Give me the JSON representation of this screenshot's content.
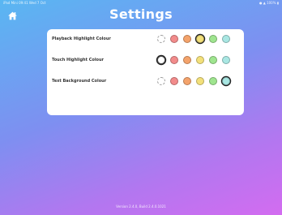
{
  "status_bar": {
    "left": "iPad Mini  09:41  Wed 7 Oct",
    "right": "● ▲ 100% ▮"
  },
  "home": {
    "icon": "home-icon"
  },
  "title": "Settings",
  "rows": [
    {
      "label": "Playback Highlight Colour",
      "swatches": [
        {
          "color": "transparent",
          "dashed": true,
          "selected": false
        },
        {
          "color": "#f28b8b",
          "selected": false
        },
        {
          "color": "#f4a36b",
          "selected": false
        },
        {
          "color": "#f3e07a",
          "selected": true
        },
        {
          "color": "#9fe58f",
          "selected": false
        },
        {
          "color": "#a9e7e3",
          "selected": false
        }
      ]
    },
    {
      "label": "Touch Highlight Colour",
      "swatches": [
        {
          "color": "transparent",
          "dashed": false,
          "selected": true
        },
        {
          "color": "#f28b8b",
          "selected": false
        },
        {
          "color": "#f4a36b",
          "selected": false
        },
        {
          "color": "#f3e07a",
          "selected": false
        },
        {
          "color": "#9fe58f",
          "selected": false
        },
        {
          "color": "#a9e7e3",
          "selected": false
        }
      ]
    },
    {
      "label": "Text Background Colour",
      "swatches": [
        {
          "color": "transparent",
          "dashed": true,
          "selected": false
        },
        {
          "color": "#f28b8b",
          "selected": false
        },
        {
          "color": "#f4a36b",
          "selected": false
        },
        {
          "color": "#f3e07a",
          "selected": false
        },
        {
          "color": "#9fe58f",
          "selected": false
        },
        {
          "color": "#a9e7e3",
          "selected": true
        }
      ]
    }
  ],
  "footer": {
    "version": "Version 2.4.0, Build 2.4.0.1021"
  }
}
